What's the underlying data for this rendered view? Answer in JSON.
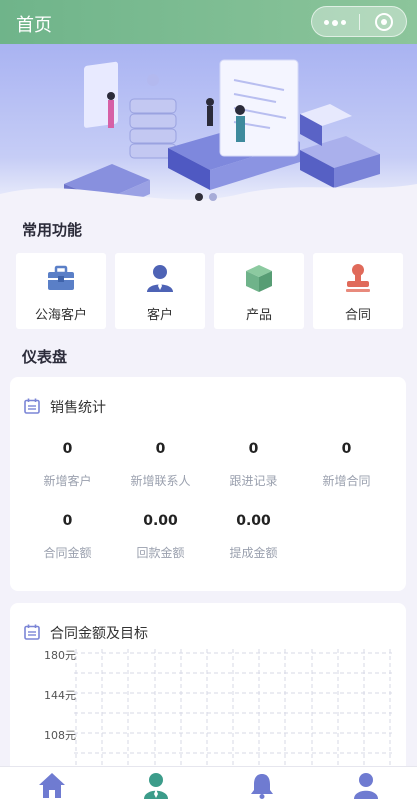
{
  "header": {
    "title": "首页"
  },
  "banner": {
    "slides": 2,
    "active": 0
  },
  "sections": {
    "common": "常用功能",
    "dashboard": "仪表盘"
  },
  "functions": [
    {
      "label": "公海客户",
      "icon": "toolbox-icon",
      "color": "#5a7fc7"
    },
    {
      "label": "客户",
      "icon": "customer-icon",
      "color": "#4e63b5"
    },
    {
      "label": "产品",
      "icon": "box-icon",
      "color": "#6fb38a"
    },
    {
      "label": "合同",
      "icon": "stamp-icon",
      "color": "#e06a5a"
    }
  ],
  "sales": {
    "title": "销售统计",
    "stats": [
      {
        "value": "0",
        "label": "新增客户"
      },
      {
        "value": "0",
        "label": "新增联系人"
      },
      {
        "value": "0",
        "label": "跟进记录"
      },
      {
        "value": "0",
        "label": "新增合同"
      },
      {
        "value": "0",
        "label": "合同金额"
      },
      {
        "value": "0.00",
        "label": "回款金额"
      },
      {
        "value": "0.00",
        "label": "提成金额"
      }
    ]
  },
  "contract": {
    "title": "合同金额及目标",
    "y_ticks": [
      "180元",
      "144元",
      "108元"
    ]
  },
  "chart_data": {
    "type": "bar",
    "title": "合同金额及目标",
    "yticks": [
      "180元",
      "144元",
      "108元"
    ],
    "ylim": [
      108,
      180
    ],
    "grid": true
  },
  "tabbar": [
    {
      "icon": "home-icon",
      "active": true
    },
    {
      "icon": "contacts-icon",
      "active": false
    },
    {
      "icon": "bell-icon",
      "active": false
    },
    {
      "icon": "user-icon",
      "active": false
    }
  ],
  "colors": {
    "accent": "#7b85d6",
    "header": "#7dbb93",
    "active_tab": "#6f7bd1",
    "tab_teal": "#3c9c8a"
  }
}
